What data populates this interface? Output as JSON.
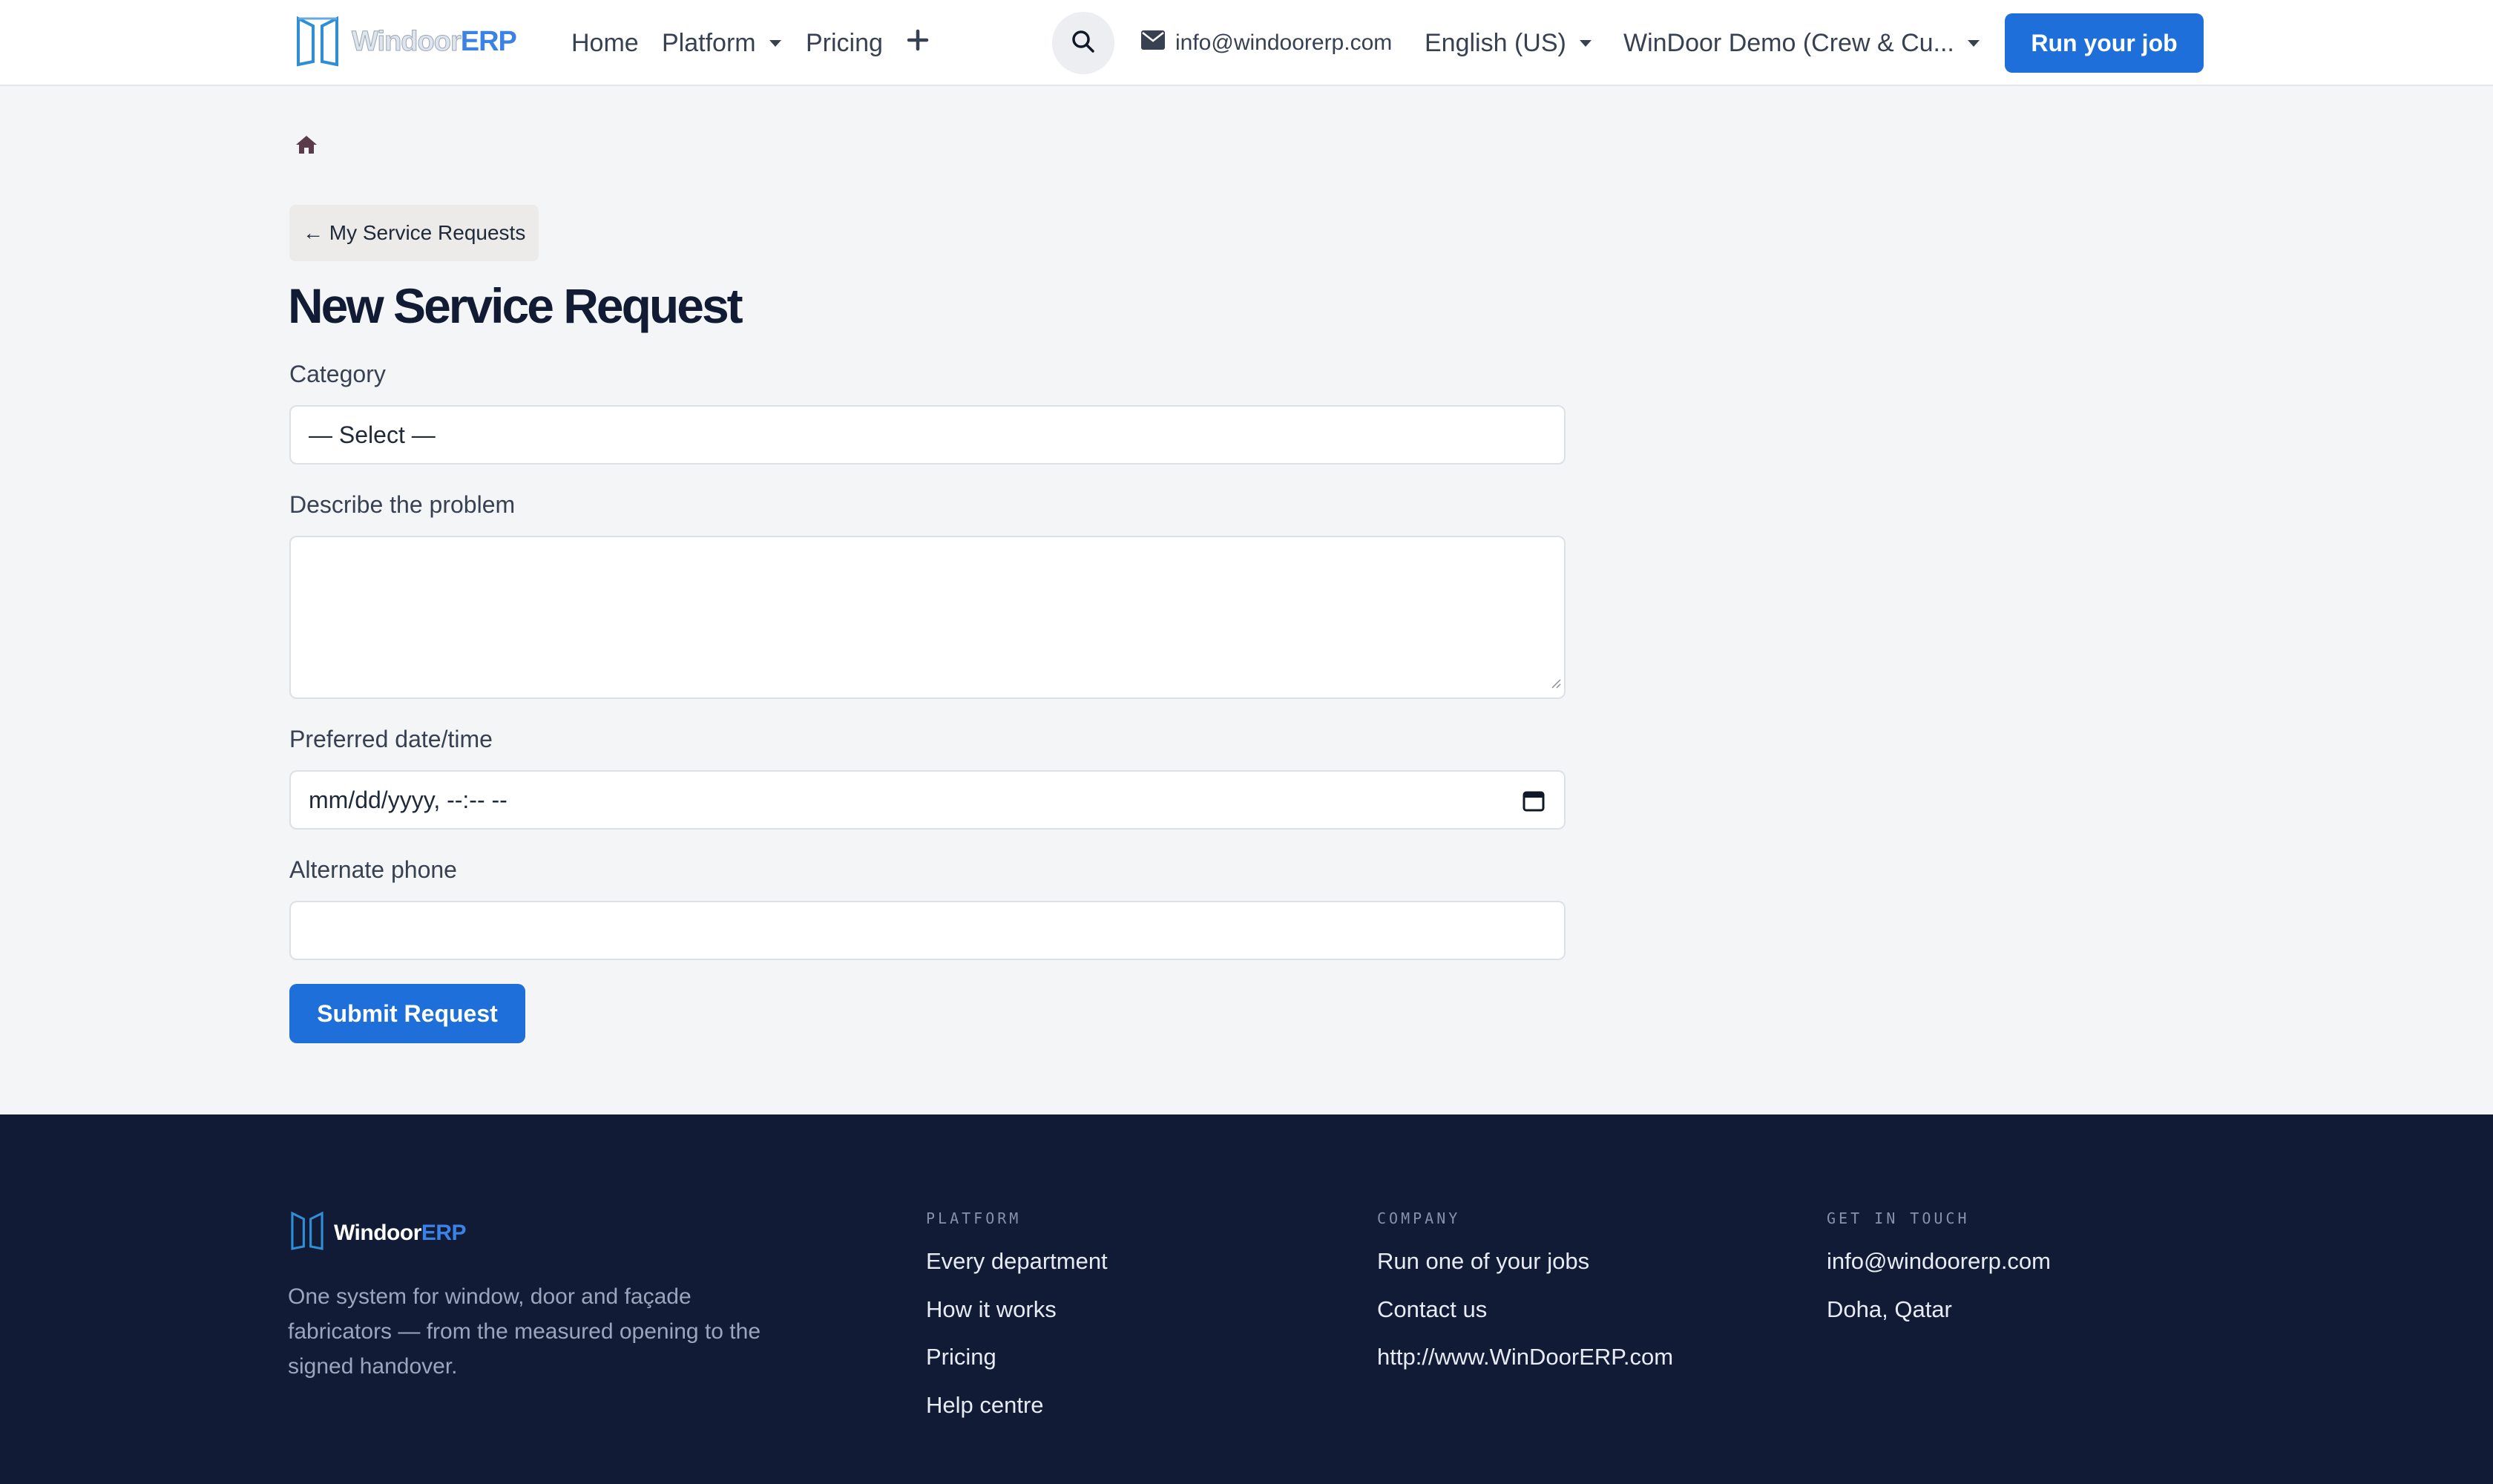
{
  "header": {
    "logo": {
      "word1": "Windoor",
      "word2": "ERP"
    },
    "nav": {
      "home": "Home",
      "platform": "Platform",
      "pricing": "Pricing",
      "add_symbol": "+"
    },
    "email": "info@windoorerp.com",
    "language": "English (US)",
    "account": "WinDoor Demo (Crew & Cu...",
    "cta": "Run your job"
  },
  "breadcrumb": {
    "home_icon": "home-icon"
  },
  "back_link": "← My Service Requests",
  "page_title": "New Service Request",
  "form": {
    "category": {
      "label": "Category",
      "value": "— Select —"
    },
    "problem": {
      "label": "Describe the problem",
      "value": ""
    },
    "preferred_datetime": {
      "label": "Preferred date/time",
      "value": "mm/dd/yyyy, --:-- --"
    },
    "alternate_phone": {
      "label": "Alternate phone",
      "value": ""
    },
    "submit": "Submit Request"
  },
  "footer": {
    "logo": {
      "word1": "Windoor",
      "word2": "ERP"
    },
    "tagline": "One system for window, door and façade fabricators — from the measured opening to the signed handover.",
    "platform": {
      "heading": "PLATFORM",
      "links": [
        "Every department",
        "How it works",
        "Pricing",
        "Help centre"
      ]
    },
    "company": {
      "heading": "COMPANY",
      "links": [
        "Run one of your jobs",
        "Contact us",
        "http://www.WinDoorERP.com"
      ]
    },
    "contact": {
      "heading": "GET IN TOUCH",
      "links": [
        "info@windoorerp.com",
        "Doha, Qatar"
      ]
    }
  },
  "colors": {
    "primary": "#1e6fd9",
    "footer_bg": "#111b35",
    "page_bg": "#f4f5f7",
    "title": "#111c34"
  },
  "icons": [
    "logo-mark-icon",
    "chevron-down-icon",
    "plus-icon",
    "search-icon",
    "envelope-icon",
    "home-icon",
    "resize-grip-icon",
    "calendar-icon"
  ]
}
